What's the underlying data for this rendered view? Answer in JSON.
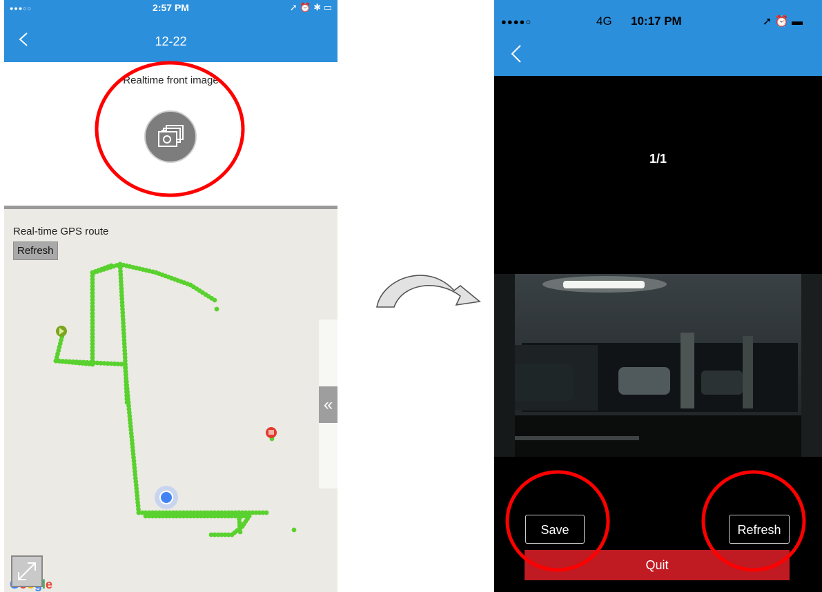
{
  "left_phone": {
    "status_bar": {
      "time": "2:57 PM"
    },
    "nav": {
      "title": "12-22"
    },
    "realtime": {
      "label": "Realtime front image"
    },
    "map": {
      "gps_label": "Real-time GPS route",
      "refresh_label": "Refresh",
      "collapse_glyph": "«",
      "google_letters": [
        {
          "ch": "G",
          "color": "#4285f4"
        },
        {
          "ch": "o",
          "color": "#ea4335"
        },
        {
          "ch": "o",
          "color": "#fbbc05"
        },
        {
          "ch": "g",
          "color": "#4285f4"
        },
        {
          "ch": "l",
          "color": "#34a853"
        },
        {
          "ch": "e",
          "color": "#ea4335"
        }
      ]
    }
  },
  "right_phone": {
    "status_bar": {
      "network": "4G",
      "time": "10:17 PM"
    },
    "page_count": "1/1",
    "save_label": "Save",
    "refresh_label": "Refresh",
    "quit_label": "Quit"
  },
  "colors": {
    "nav_blue": "#2c8fdc",
    "route_green": "#59d12e",
    "quit_red": "#c01a22",
    "annotation_red": "#ff0000"
  },
  "icons": [
    "back-chevron-icon",
    "camera-icon",
    "play-marker-icon",
    "stop-marker-icon",
    "location-dot-icon",
    "fullscreen-icon",
    "curved-arrow-icon"
  ]
}
